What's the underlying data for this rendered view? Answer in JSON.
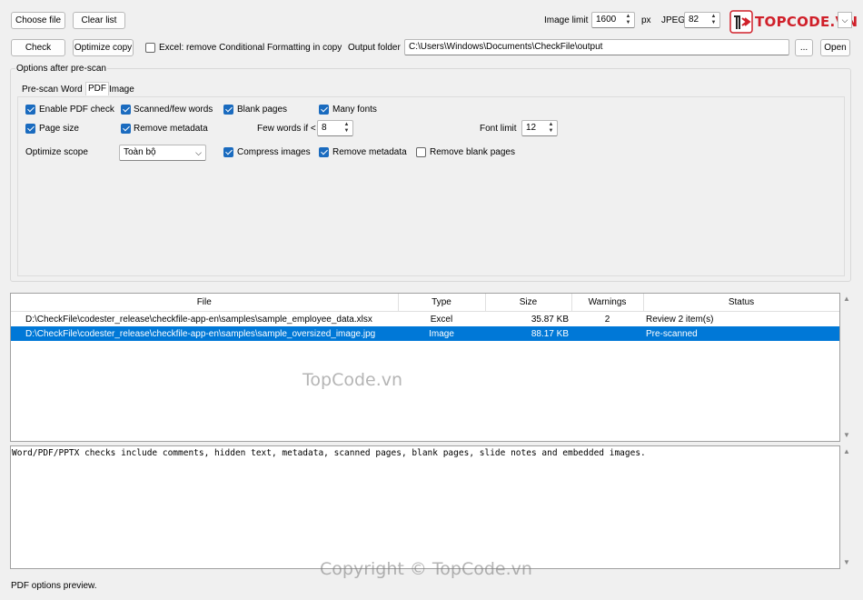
{
  "toolbar": {
    "choose_file": "Choose file",
    "clear_list": "Clear list",
    "image_limit_label": "Image limit",
    "image_limit_value": "1600",
    "px_label": "px",
    "jpeg_label": "JPEG",
    "jpeg_value": "82",
    "check": "Check",
    "optimize_copy": "Optimize copy",
    "excel_remove_cf": "Excel: remove Conditional Formatting in copy",
    "output_folder_label": "Output folder",
    "output_folder_value": "C:\\Users\\Windows\\Documents\\CheckFile\\output",
    "browse": "...",
    "open": "Open"
  },
  "logo": {
    "text": "TOPCODE.VN"
  },
  "options": {
    "group_title": "Options after pre-scan",
    "tabs": [
      "Pre-scan",
      "Word",
      "PDF",
      "Image"
    ],
    "active_tab": "PDF",
    "enable_pdf_check": "Enable PDF check",
    "scanned_few_words": "Scanned/few words",
    "blank_pages": "Blank pages",
    "many_fonts": "Many fonts",
    "page_size": "Page size",
    "remove_metadata_1": "Remove metadata",
    "few_words_label": "Few words if <",
    "few_words_value": "8",
    "font_limit_label": "Font limit",
    "font_limit_value": "12",
    "optimize_scope_label": "Optimize scope",
    "optimize_scope_value": "Toàn bộ",
    "compress_images": "Compress images",
    "remove_metadata_2": "Remove metadata",
    "remove_blank_pages": "Remove blank pages"
  },
  "table": {
    "headers": [
      "File",
      "Type",
      "Size",
      "Warnings",
      "Status"
    ],
    "rows": [
      [
        "D:\\CheckFile\\codester_release\\checkfile-app-en\\samples\\sample_employee_data.xlsx",
        "Excel",
        "35.87 KB",
        "2",
        "Review 2 item(s)"
      ],
      [
        "D:\\CheckFile\\codester_release\\checkfile-app-en\\samples\\sample_oversized_image.jpg",
        "Image",
        "88.17 KB",
        "",
        "Pre-scanned"
      ]
    ]
  },
  "details": {
    "text": "Word/PDF/PPTX checks include comments, hidden text, metadata, scanned pages, blank pages, slide notes and embedded images."
  },
  "watermarks": {
    "center": "TopCode.vn",
    "bottom": "Copyright © TopCode.vn"
  },
  "status_bar": {
    "text": "PDF options preview."
  },
  "colors": {
    "selection": "#0078d7",
    "checkbox": "#1a6bbf",
    "logo_red": "#d0202a"
  }
}
